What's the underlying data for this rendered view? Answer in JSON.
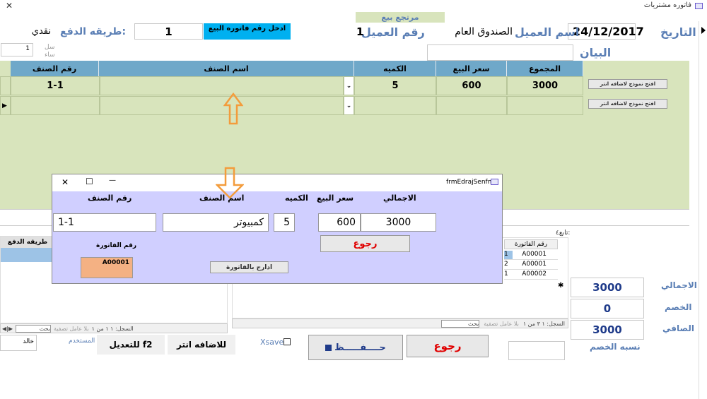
{
  "window": {
    "title": "فاتوره مشتريات",
    "close": "✕"
  },
  "header": {
    "return_sale": "مرتجع بيع",
    "date_label": "التاريخ",
    "date_value": "24/12/2017",
    "customer_label": "اسم العميل",
    "customer_value": "الصندوق العام",
    "customer_no_label": "رقم العميل",
    "customer_no_value": "1",
    "invoice_entry_label": "ادخل رقم فاتوره البيع",
    "invoice_entry_value": "1",
    "payment_label": "طريقه الدفع:",
    "payment_value": "نقدي",
    "desc_label": "البيان",
    "small_box_value": "1",
    "small_label_a": "سل",
    "small_label_b": "ساء"
  },
  "grid": {
    "columns": [
      "رقم الصنف",
      "اسم الصنف",
      "الكميه",
      "سعر البيع",
      "المجموع"
    ],
    "rows": [
      {
        "code": "1-1",
        "name": "",
        "qty": "5",
        "price": "600",
        "total": "3000"
      },
      {
        "code": "",
        "name": "",
        "qty": "",
        "price": "",
        "total": ""
      }
    ],
    "open_form_btn": "افتح نموذج لاضافه انتر",
    "record_pointer": "▶"
  },
  "dialog": {
    "title": "frmEdrajSenfm",
    "minimize": "—",
    "maximize": "☐",
    "close": "✕",
    "labels": {
      "code": "رقم الصنف",
      "name": "اسم الصنف",
      "qty": "الكميه",
      "price": "سعر البيع",
      "total": "الاجمالي"
    },
    "values": {
      "code": "1-1",
      "name": "كمبيوتر",
      "qty": "5",
      "price": "600",
      "total": "3000"
    },
    "return_btn": "رجوع",
    "invoice_no_label": "رقم الفاتورة",
    "invoice_no_value": "A00001",
    "insert_btn": "ادارج بالفاتورة"
  },
  "subgrid": {
    "label": "تابع٤:",
    "col_invoice": "رقم الفاتورة",
    "rows": [
      {
        "n": "1",
        "inv": "A00001"
      },
      {
        "n": "2",
        "inv": "A00001"
      },
      {
        "n": "1",
        "inv": "A00002"
      }
    ],
    "new_row": "✱",
    "nav_record": "السجل: ١ ٣ من ١",
    "nav_nofilter": "بلا عامل تصفية",
    "nav_search": "بحث"
  },
  "leftgrid": {
    "col_payment": "طريقه الدفع",
    "nav_record": "السجل: ١ ١ من ١",
    "nav_nofilter": "بلا عامل تصفية",
    "nav_search": "بحث",
    "user_label": "المستخدم",
    "user_value": "خالد"
  },
  "totals": {
    "total_label": "الاجمالي",
    "total_value": "3000",
    "discount_label": "الخصم",
    "discount_value": "0",
    "net_label": "الصافي",
    "net_value": "3000",
    "discount_pct_label": "نسبه الخصم"
  },
  "bottom": {
    "edit_btn": "للتعديل f2",
    "add_enter_btn": "للاضافه انتر",
    "xsave_label": "Xsave",
    "save_btn": "حــــفـــــظ",
    "return_btn": "رجوع"
  },
  "colors": {
    "header_blue": "#6fa8c9",
    "grid_green": "#d8e4bc",
    "dialog_lavender": "#d0cfff",
    "entry_cyan": "#00b0f0",
    "orange_arrow": "#f39c3c",
    "red_text": "#e00000",
    "invoice_orange": "#f4b183"
  }
}
